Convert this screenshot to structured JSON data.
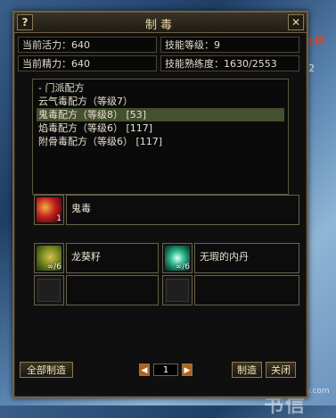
{
  "window": {
    "title": "制毒",
    "help_icon": "?",
    "close_icon": "✕"
  },
  "stats": {
    "vitality_label": "当前活力",
    "vitality_value": "640",
    "energy_label": "当前精力",
    "energy_value": "640",
    "skill_level_label": "技能等级",
    "skill_level_value": "9",
    "proficiency_label": "技能熟练度",
    "proficiency_value": "1630/2553"
  },
  "recipes": {
    "group_header": "- 门派配方",
    "items": [
      {
        "label": "云气毒配方（等级7）",
        "selected": false
      },
      {
        "label": "鬼毒配方（等级8） [53]",
        "selected": true
      },
      {
        "label": "焰毒配方（等级6） [117]",
        "selected": false
      },
      {
        "label": "附骨毒配方（等级6） [117]",
        "selected": false
      }
    ]
  },
  "product": {
    "name": "鬼毒",
    "count": "1",
    "icon": "ghost-poison-icon"
  },
  "materials": [
    {
      "name": "龙葵籽",
      "count": "∞/6",
      "icon": "nightshade-seed-icon"
    },
    {
      "name": "无瑕的内丹",
      "count": "∞/6",
      "icon": "flawless-inner-elixir-icon"
    }
  ],
  "footer": {
    "make_all": "全部制造",
    "page": "1",
    "prev_icon": "◀",
    "next_icon": "▶",
    "make": "制造",
    "close": "关闭"
  },
  "background": {
    "top_right_text": "九转",
    "top_right_num": "2",
    "watermark_logo": "网游 书信",
    "watermark_url": "www.sxdsy.com"
  },
  "colors": {
    "frame": "#6f6146",
    "selected_row": "#455030",
    "title_text": "#e9d9a6"
  }
}
